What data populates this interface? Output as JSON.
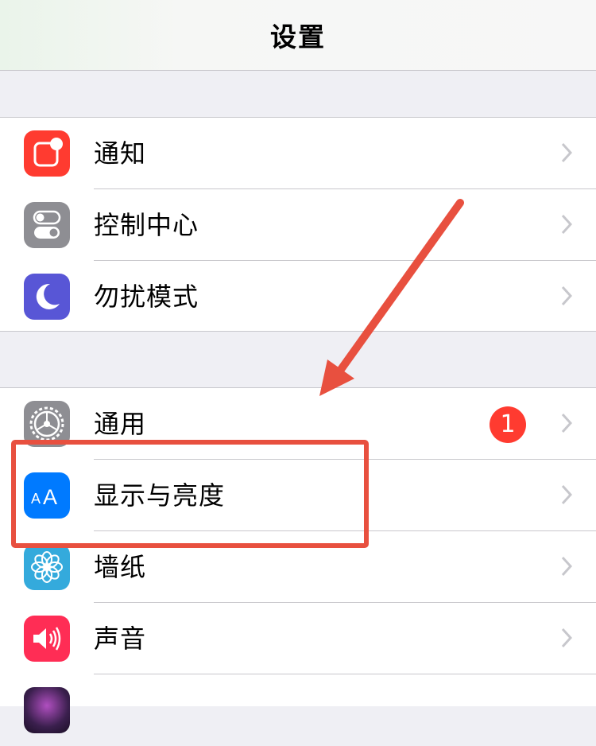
{
  "navbar": {
    "title": "设置"
  },
  "group1": [
    {
      "label": "通知",
      "icon": "notifications-icon",
      "color": "#ff3b30"
    },
    {
      "label": "控制中心",
      "icon": "control-center-icon",
      "color": "#8e8e93"
    },
    {
      "label": "勿扰模式",
      "icon": "moon-icon",
      "color": "#5856d6"
    }
  ],
  "group2": [
    {
      "label": "通用",
      "icon": "gear-icon",
      "color": "#8e8e93",
      "badge": "1"
    },
    {
      "label": "显示与亮度",
      "icon": "display-brightness-icon",
      "color": "#007aff",
      "icon_text": "AA"
    },
    {
      "label": "墙纸",
      "icon": "wallpaper-flower-icon",
      "color": "#34aadc"
    },
    {
      "label": "声音",
      "icon": "speaker-icon",
      "color": "#ff2d55"
    },
    {
      "label": "",
      "icon": "siri-icon",
      "color": "#3a1f4d"
    }
  ],
  "annotation": {
    "color": "#e8503f",
    "target": "显示与亮度"
  }
}
